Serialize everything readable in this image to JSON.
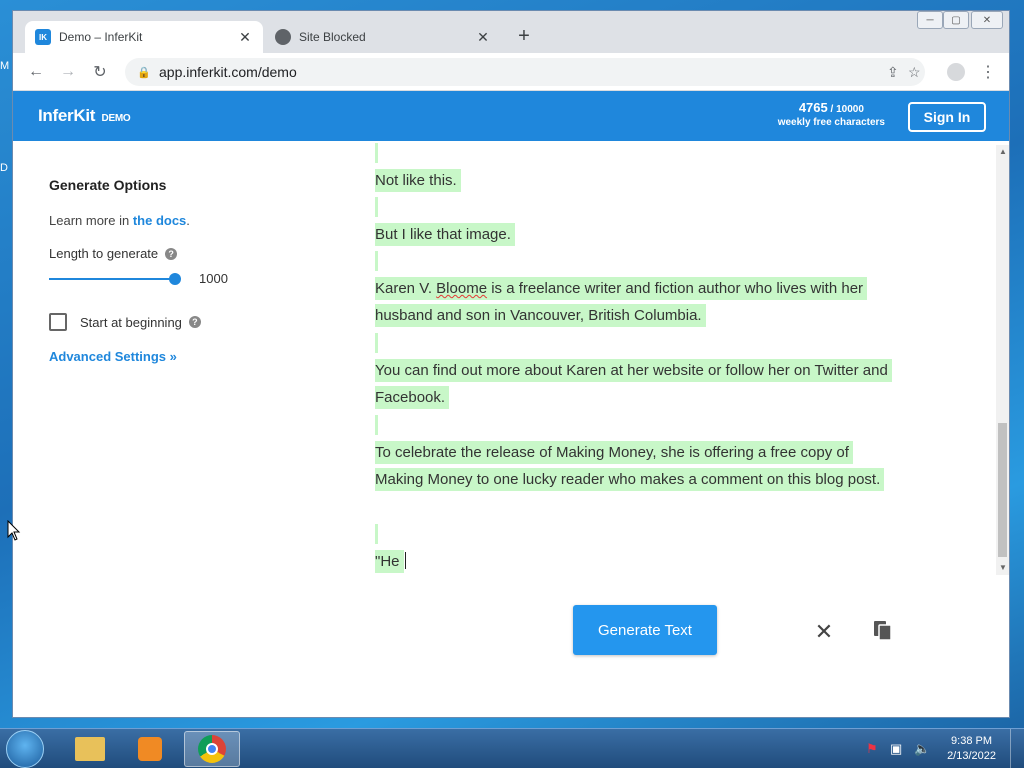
{
  "browser": {
    "tabs": [
      {
        "title": "Demo – InferKit",
        "favicon": "IK",
        "active": true
      },
      {
        "title": "Site Blocked",
        "active": false
      }
    ],
    "url": "app.inferkit.com/demo"
  },
  "appbar": {
    "brand": "InferKit",
    "brand_tag": "DEMO",
    "credits_used": "4765",
    "credits_total": "/ 10000",
    "credits_label": "weekly free characters",
    "signin_label": "Sign In"
  },
  "sidebar": {
    "title": "Generate Options",
    "docs_prefix": "Learn more in ",
    "docs_link": "the docs",
    "docs_suffix": ".",
    "length_label": "Length to generate",
    "length_value": "1000",
    "length_fraction": 1.0,
    "start_label": "Start at beginning",
    "start_checked": false,
    "advanced_label": "Advanced Settings »"
  },
  "editor": {
    "paragraphs": [
      "Not like this.",
      "But I like that image.",
      "Karen V. Bloome is a freelance writer and fiction author who lives with her husband and son in Vancouver, British Columbia.",
      "You can find out more about Karen at her website or follow her on Twitter and Facebook.",
      "To celebrate the release of Making Money, she is offering a free copy of Making Money to one lucky reader who makes a comment on this blog post.",
      "\"He"
    ],
    "highlight_color": "#c8f7c8"
  },
  "actions": {
    "generate_label": "Generate Text"
  },
  "taskbar": {
    "time": "9:38 PM",
    "date": "2/13/2022"
  },
  "colors": {
    "accent": "#1f87dc",
    "button": "#2496ee"
  }
}
